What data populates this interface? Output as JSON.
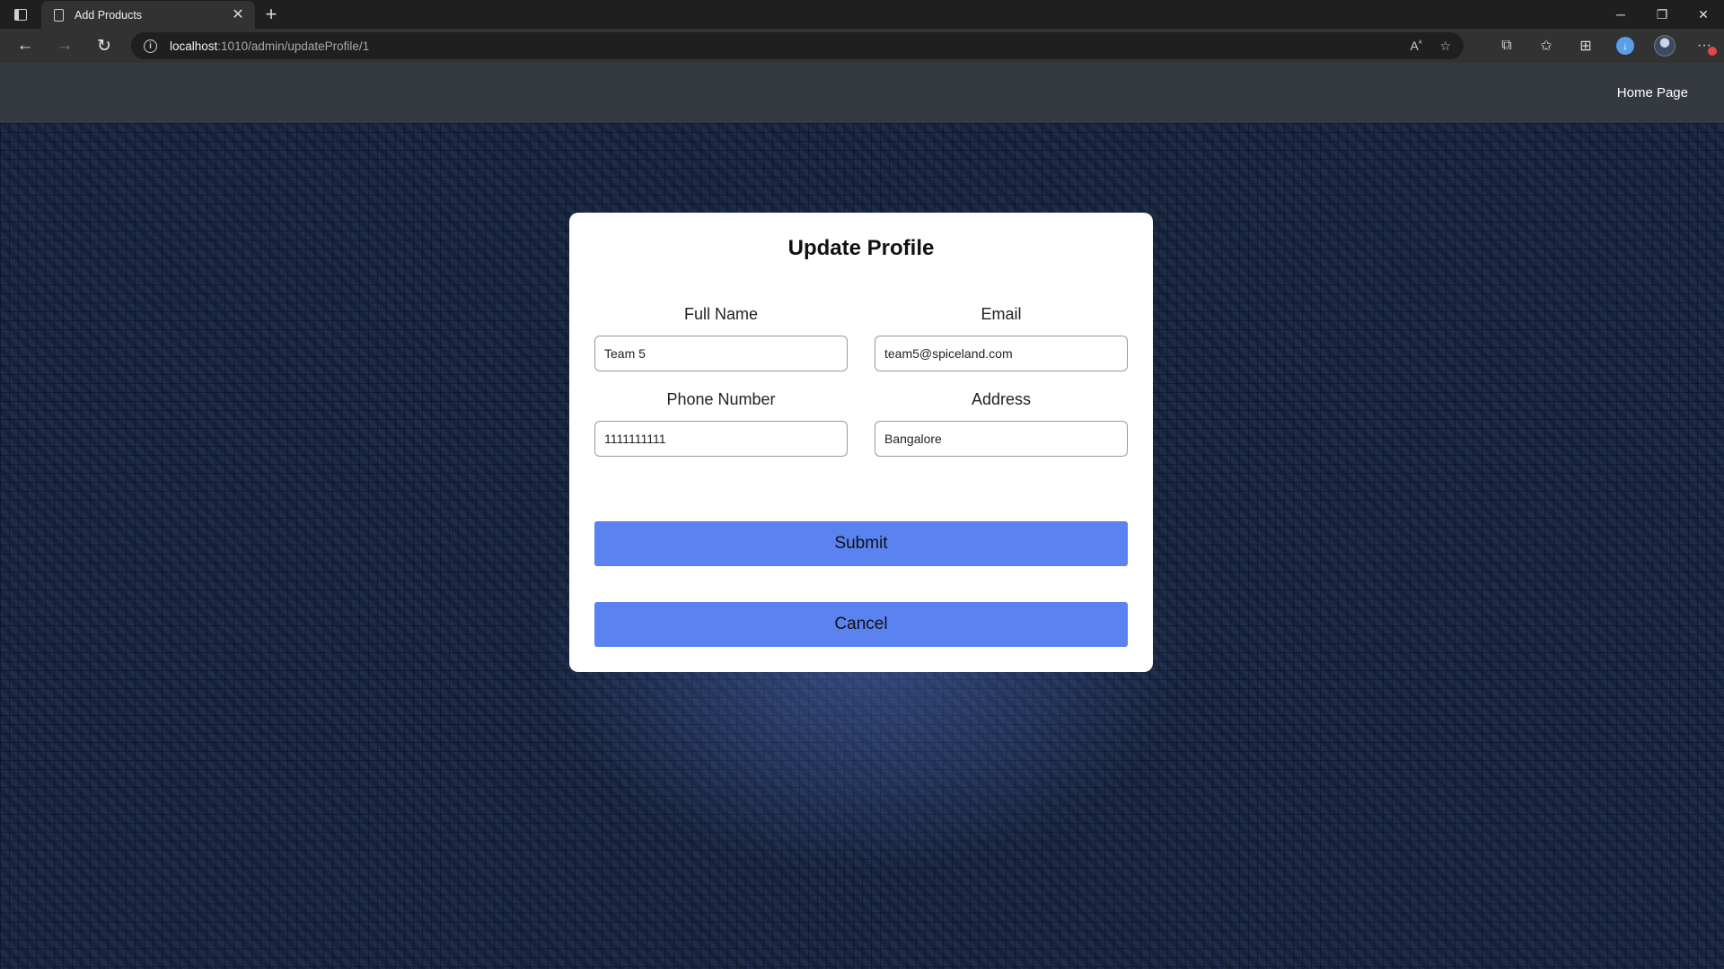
{
  "browser": {
    "tab_title": "Add Products",
    "url_host": "localhost",
    "url_path": ":1010/admin/updateProfile/1"
  },
  "navbar": {
    "home_link": "Home Page"
  },
  "form": {
    "title": "Update Profile",
    "full_name": {
      "label": "Full Name",
      "value": "Team 5"
    },
    "email": {
      "label": "Email",
      "value": "team5@spiceland.com"
    },
    "phone": {
      "label": "Phone Number",
      "value": "1111111111"
    },
    "address": {
      "label": "Address",
      "value": "Bangalore"
    },
    "submit_label": "Submit",
    "cancel_label": "Cancel"
  },
  "colors": {
    "navbar_bg": "#343a40",
    "button_bg": "#5a82f0",
    "card_bg": "#ffffff"
  },
  "icons": [
    "tab-actions-icon",
    "page-icon",
    "close-icon",
    "plus-icon",
    "back-icon",
    "forward-icon",
    "refresh-icon",
    "info-icon",
    "read-aloud-icon",
    "favorite-icon",
    "extensions-icon",
    "favorites-icon",
    "collections-icon",
    "download-icon",
    "profile-avatar",
    "more-icon"
  ]
}
